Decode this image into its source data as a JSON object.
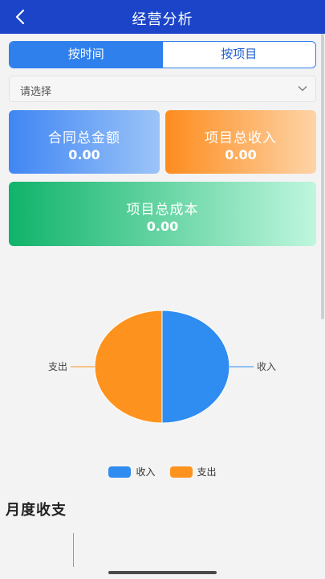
{
  "header": {
    "title": "经营分析"
  },
  "tabs": [
    {
      "label": "按时间",
      "active": true
    },
    {
      "label": "按项目",
      "active": false
    }
  ],
  "select": {
    "text": "请选择"
  },
  "cards": {
    "contract": {
      "label": "合同总金额",
      "value": "0.00"
    },
    "income": {
      "label": "项目总收入",
      "value": "0.00"
    },
    "cost": {
      "label": "项目总成本",
      "value": "0.00"
    }
  },
  "chart_data": {
    "type": "pie",
    "categories": [
      "收入",
      "支出"
    ],
    "values": [
      1,
      1
    ],
    "colors": [
      "#2f8cf0",
      "#fd931e"
    ],
    "legend_position": "bottom"
  },
  "section": {
    "title": "月度收支"
  },
  "colors": {
    "header": "#1b44c8",
    "accent": "#2f80ed",
    "income": "#2f8cf0",
    "expense": "#fd931e"
  }
}
